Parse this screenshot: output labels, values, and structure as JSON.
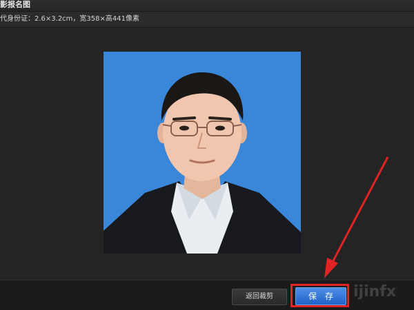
{
  "window": {
    "title": "影报名图"
  },
  "info": {
    "text": "代身份证：2.6×3.2cm，宽358×高441像素"
  },
  "photo": {
    "icon": "id-photo-portrait",
    "background_color": "#3a86d8"
  },
  "footer": {
    "back_label": "返回裁剪",
    "save_label": "保存",
    "watermark": "ijinfx",
    "highlight_color": "#e02424"
  }
}
